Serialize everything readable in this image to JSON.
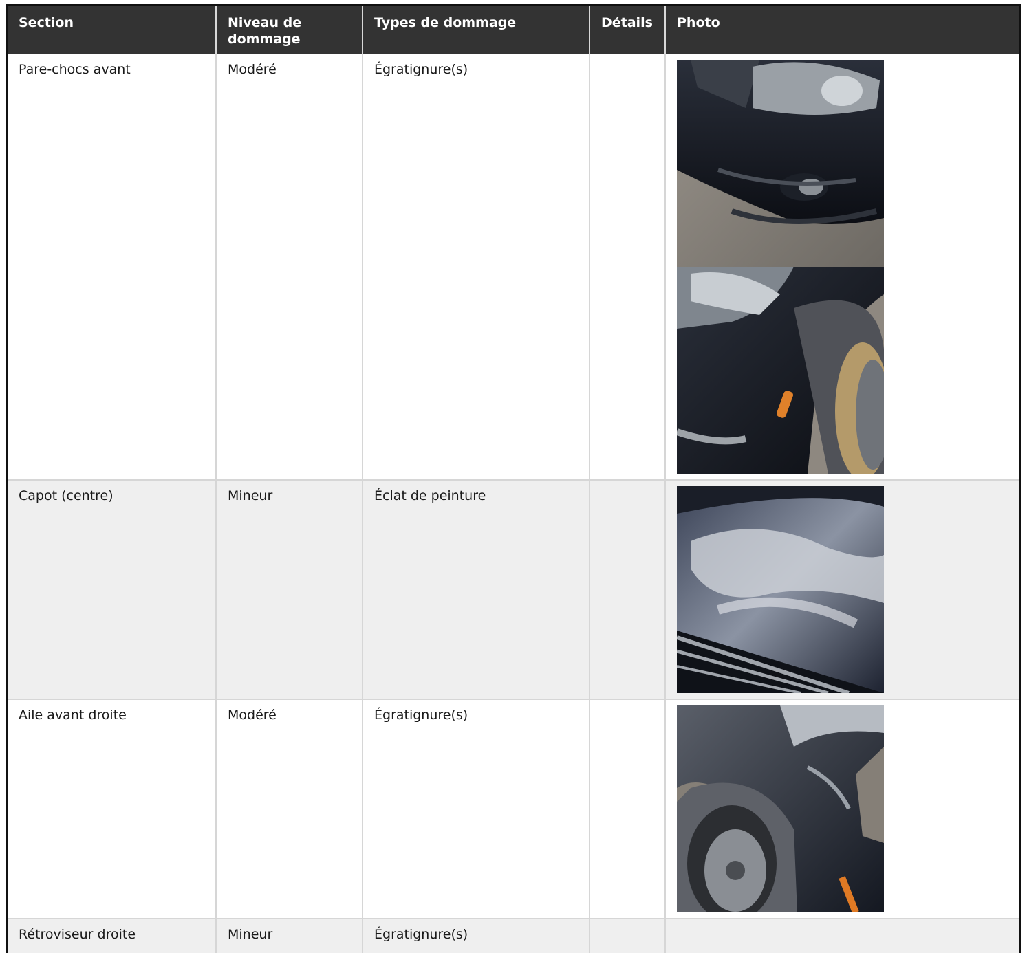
{
  "table": {
    "headers": [
      "Section",
      "Niveau de dommage",
      "Types de dommage",
      "Détails",
      "Photo"
    ],
    "rows": [
      {
        "section": "Pare-chocs avant",
        "niveau": "Modéré",
        "types": "Égratignure(s)",
        "details": "",
        "photos": [
          "front-bumper-left-photo",
          "front-bumper-right-photo"
        ]
      },
      {
        "section": "Capot (centre)",
        "niveau": "Mineur",
        "types": "Éclat de peinture",
        "details": "",
        "photos": [
          "hood-center-photo"
        ]
      },
      {
        "section": "Aile avant droite",
        "niveau": "Modéré",
        "types": "Égratignure(s)",
        "details": "",
        "photos": [
          "right-front-fender-photo"
        ]
      },
      {
        "section": "Rétroviseur droite",
        "niveau": "Mineur",
        "types": "Égratignure(s)",
        "details": "",
        "photos": []
      }
    ]
  },
  "colors": {
    "header_bg": "#333333",
    "header_text": "#ffffff",
    "alt_row": "#efefef",
    "border": "#d6d6d6"
  }
}
